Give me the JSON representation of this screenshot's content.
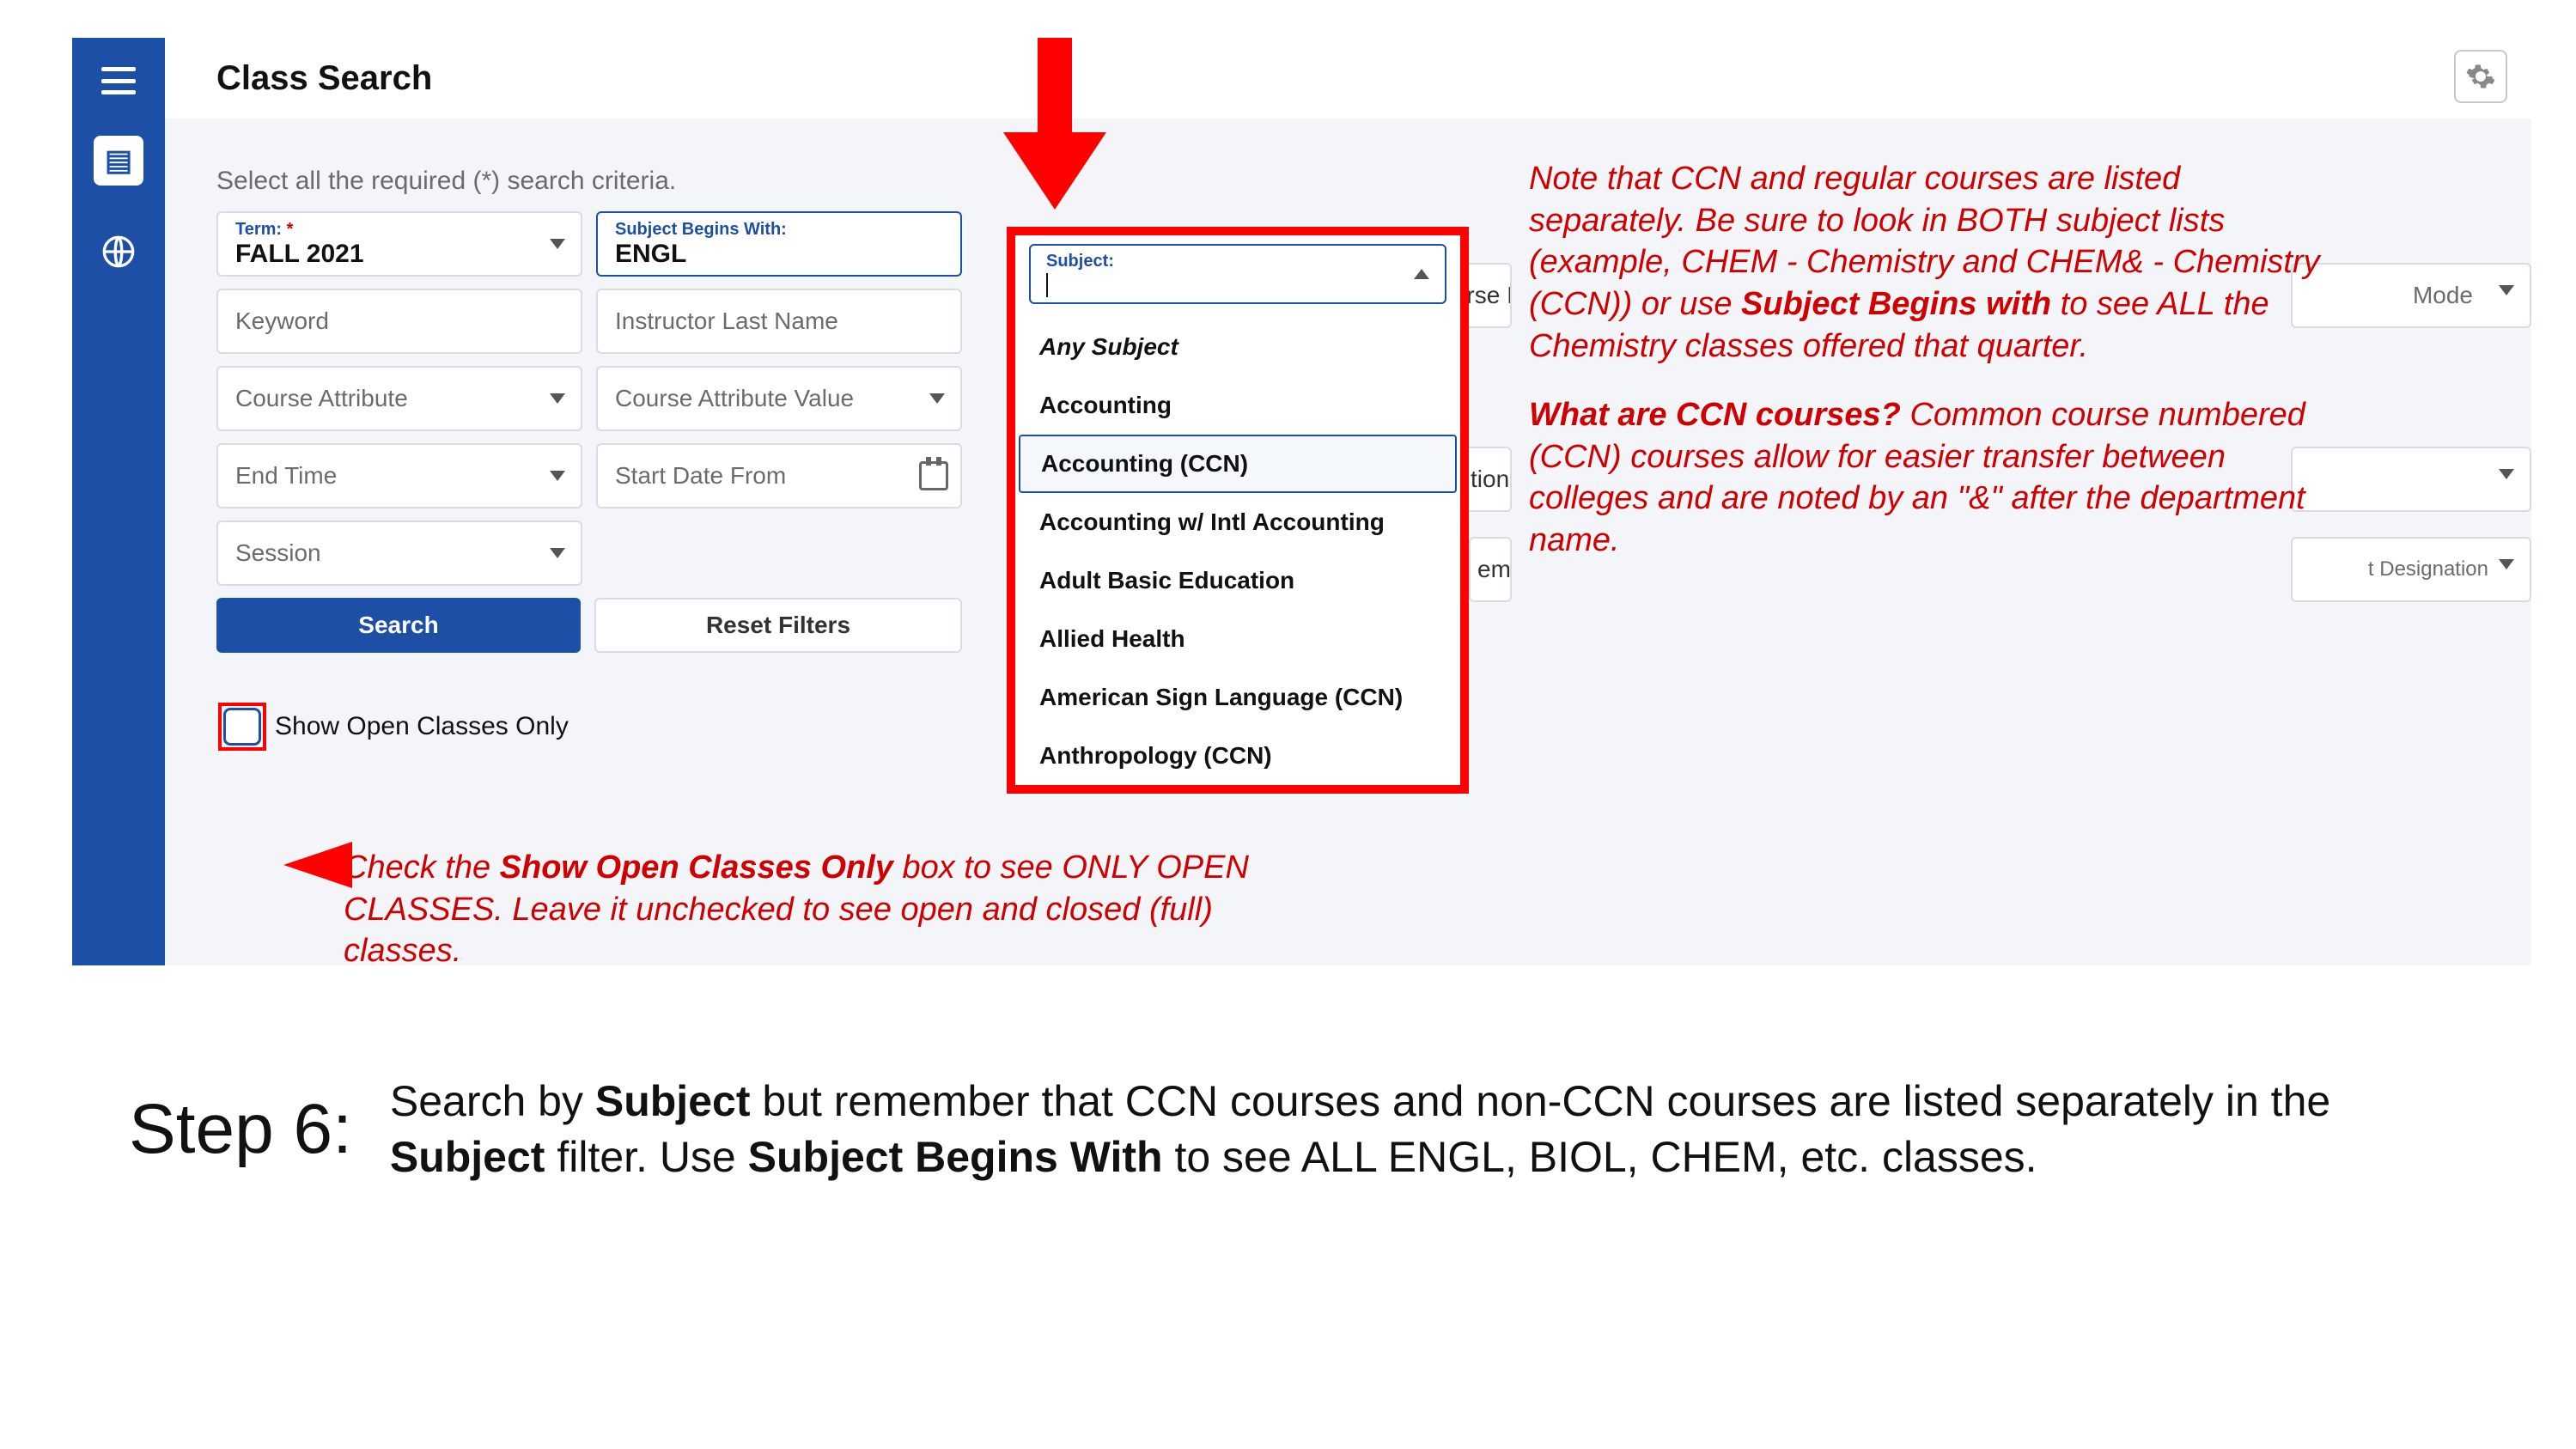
{
  "page": {
    "title": "Class Search",
    "instruction": "Select all the required (*) search criteria."
  },
  "fields": {
    "term_label": "Term: ",
    "term_required": "*",
    "term_value": "FALL 2021",
    "subject_begins_label": "Subject Begins With:",
    "subject_begins_value": "ENGL",
    "subject_label": "Subject:",
    "keyword_ph": "Keyword",
    "instructor_ph": "Instructor Last Name",
    "course_attr_ph": "Course Attribute",
    "course_attr_val_ph": "Course Attribute Value",
    "end_time_ph": "End Time",
    "start_date_ph": "Start Date From",
    "session_ph": "Session"
  },
  "subject_options": [
    "Any Subject",
    "Accounting",
    "Accounting (CCN)",
    "Accounting w/ Intl Accounting",
    "Adult Basic Education",
    "Allied Health",
    "American Sign Language (CCN)",
    "Anthropology (CCN)"
  ],
  "buttons": {
    "search": "Search",
    "reset": "Reset Filters"
  },
  "checkbox_label": "Show Open Classes Only",
  "truncated": {
    "course_btn": "Course I",
    "tion": "tion",
    "em": "em",
    "mode": "Mode",
    "designation": "t Designation"
  },
  "annotations": {
    "note1_a": "Note that CCN and regular courses are listed separately. Be sure to look in BOTH subject lists (example, CHEM - Chemistry and CHEM& - Chemistry (CCN)) or use ",
    "note1_b": "Subject Begins with",
    "note1_c": " to see ALL the Chemistry classes offered that quarter.",
    "note2_a": "What are CCN courses?",
    "note2_b": " Common course numbered (CCN) courses allow for easier transfer between colleges and are noted by an \"&\" after the department name.",
    "checknote_a": "Check the ",
    "checknote_b": "Show Open Classes Only",
    "checknote_c": " box to see ONLY OPEN CLASSES. Leave it unchecked to see open and closed (full) classes."
  },
  "step": {
    "label": "Step 6:",
    "desc_a": "Search by ",
    "desc_b": "Subject",
    "desc_c": " but remember that CCN courses and non-CCN courses are listed separately in the ",
    "desc_d": "Subject",
    "desc_e": " filter. Use ",
    "desc_f": "Subject Begins With",
    "desc_g": " to see ALL ENGL, BIOL, CHEM, etc. classes."
  }
}
